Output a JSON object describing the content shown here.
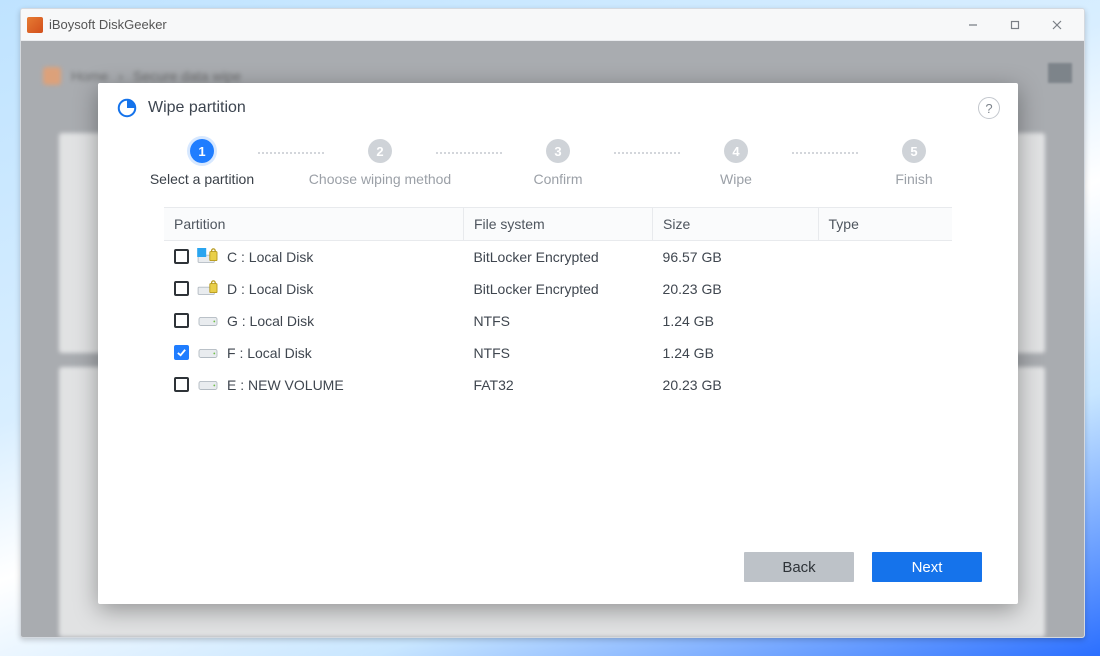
{
  "app": {
    "title": "iBoysoft DiskGeeker"
  },
  "background": {
    "breadcrumb_home": "Home",
    "breadcrumb_current": "Secure data wipe"
  },
  "modal": {
    "title": "Wipe partition",
    "steps": [
      {
        "num": "1",
        "label": "Select a partition",
        "active": true
      },
      {
        "num": "2",
        "label": "Choose wiping method",
        "active": false
      },
      {
        "num": "3",
        "label": "Confirm",
        "active": false
      },
      {
        "num": "4",
        "label": "Wipe",
        "active": false
      },
      {
        "num": "5",
        "label": "Finish",
        "active": false
      }
    ],
    "columns": {
      "partition": "Partition",
      "filesystem": "File system",
      "size": "Size",
      "type": "Type"
    },
    "rows": [
      {
        "checked": false,
        "icon": "locked-win",
        "name": "C : Local Disk",
        "filesystem": "BitLocker Encrypted",
        "size": "96.57 GB",
        "type": ""
      },
      {
        "checked": false,
        "icon": "locked",
        "name": "D : Local Disk",
        "filesystem": "BitLocker Encrypted",
        "size": "20.23 GB",
        "type": ""
      },
      {
        "checked": false,
        "icon": "drive",
        "name": "G : Local Disk",
        "filesystem": "NTFS",
        "size": "1.24 GB",
        "type": ""
      },
      {
        "checked": true,
        "icon": "drive",
        "name": "F : Local Disk",
        "filesystem": "NTFS",
        "size": "1.24 GB",
        "type": ""
      },
      {
        "checked": false,
        "icon": "drive",
        "name": "E : NEW VOLUME",
        "filesystem": "FAT32",
        "size": "20.23 GB",
        "type": ""
      }
    ],
    "buttons": {
      "back": "Back",
      "next": "Next"
    }
  }
}
